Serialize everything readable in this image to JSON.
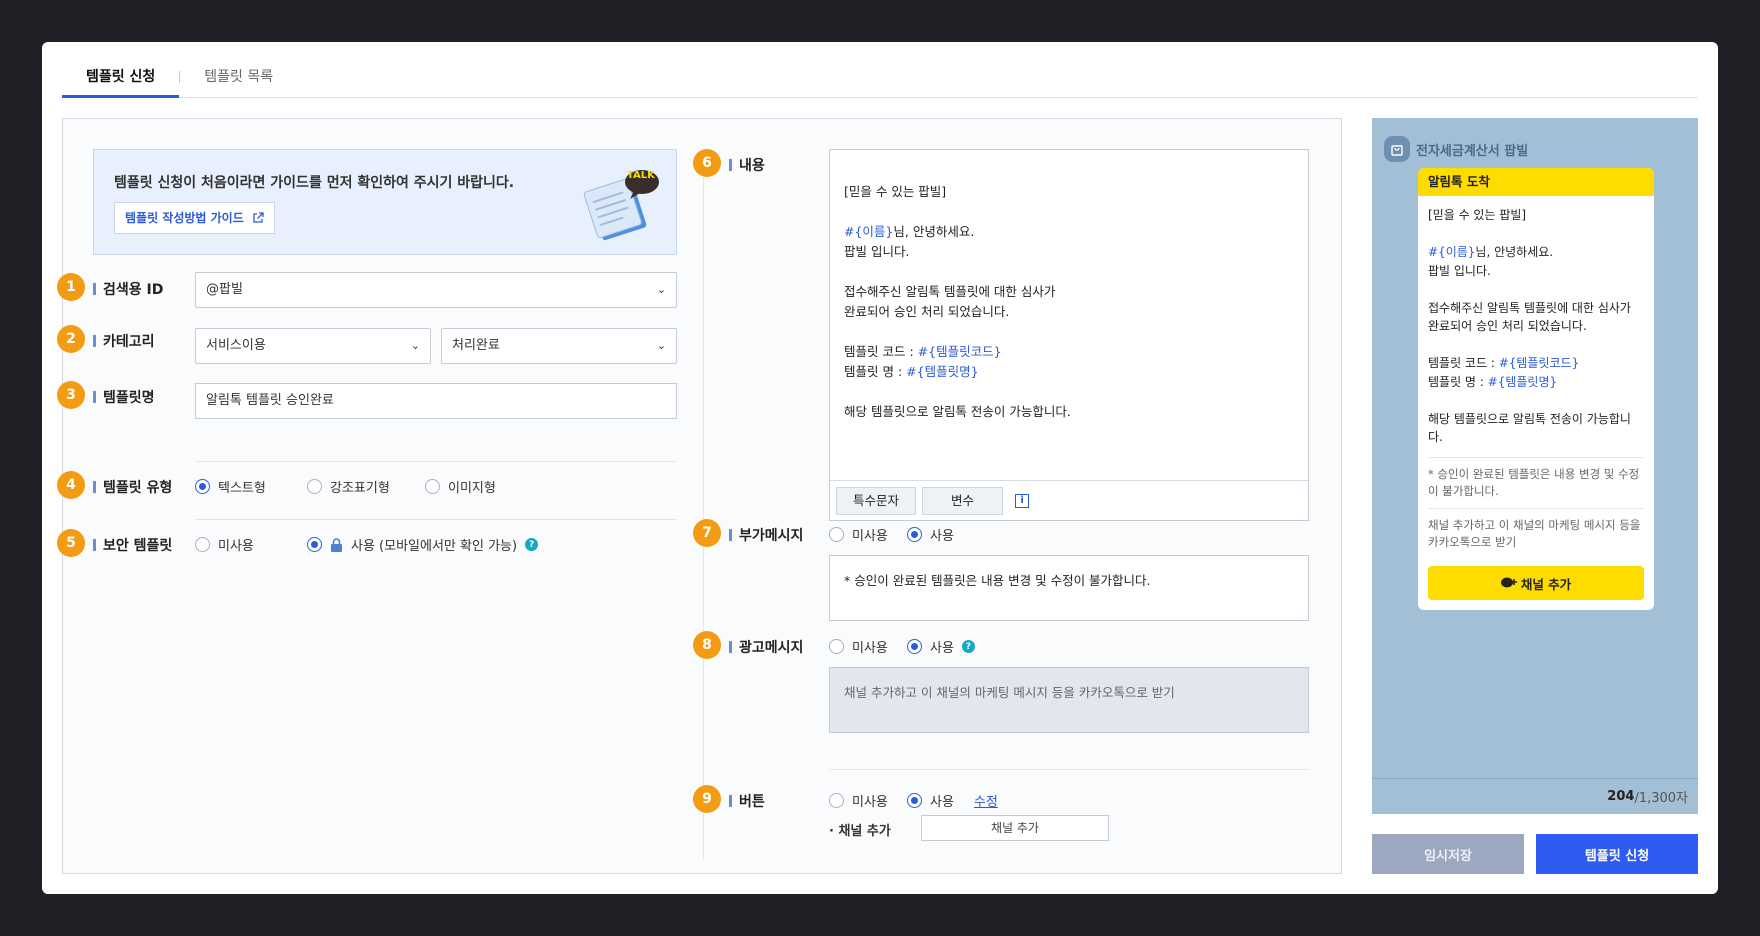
{
  "tabs": [
    {
      "label": "템플릿 신청",
      "active": true
    },
    {
      "label": "템플릿 목록",
      "active": false
    }
  ],
  "guide": {
    "text": "템플릿 신청이 처음이라면 가이드를 먼저 확인하여 주시기 바랍니다.",
    "button": "템플릿 작성방법 가이드",
    "talk": "TALK"
  },
  "fields": {
    "search_id": {
      "num": "1",
      "label": "검색용 ID",
      "value": "@팝빌"
    },
    "category": {
      "num": "2",
      "label": "카테고리",
      "value1": "서비스이용",
      "value2": "처리완료"
    },
    "name": {
      "num": "3",
      "label": "템플릿명",
      "value": "알림톡 템플릿 승인완료"
    },
    "type": {
      "num": "4",
      "label": "템플릿 유형",
      "options": [
        "텍스트형",
        "강조표기형",
        "이미지형"
      ],
      "selected": "텍스트형"
    },
    "secure": {
      "num": "5",
      "label": "보안 템플릿",
      "options": [
        "미사용",
        "사용 (모바일에서만 확인 가능)"
      ],
      "selected": "사용 (모바일에서만 확인 가능)",
      "help": "?"
    }
  },
  "content": {
    "num": "6",
    "label": "내용",
    "lines": [
      "[믿을 수 있는 팝빌]",
      "",
      "#{이름}|님, 안녕하세요.",
      "팝빌 입니다.",
      "",
      "접수해주신 알림톡 템플릿에 대한 심사가",
      "완료되어 승인 처리 되었습니다.",
      "",
      "템플릿 코드 : |#{템플릿코드}",
      "템플릿 명 : |#{템플릿명}",
      "",
      "해당 템플릿으로 알림톡 전송이 가능합니다."
    ],
    "text_1": "[믿을 수 있는 팝빌]",
    "var_name": "#{이름}",
    "text_2": "님, 안녕하세요.",
    "text_3": "팝빌 입니다.",
    "text_4": "접수해주신 알림톡 템플릿에 대한 심사가",
    "text_5": "완료되어 승인 처리 되었습니다.",
    "text_6": "템플릿 코드 : ",
    "var_code": "#{템플릿코드}",
    "text_7": "템플릿 명 : ",
    "var_tname": "#{템플릿명}",
    "text_8": "해당 템플릿으로 알림톡 전송이 가능합니다.",
    "special_chars": "특수문자",
    "variable": "변수",
    "info": "i"
  },
  "extra_msg": {
    "num": "7",
    "label": "부가메시지",
    "options": [
      "미사용",
      "사용"
    ],
    "selected": "사용",
    "text": "* 승인이 완료된 템플릿은 내용 변경 및 수정이 불가합니다."
  },
  "ad_msg": {
    "num": "8",
    "label": "광고메시지",
    "options": [
      "미사용",
      "사용"
    ],
    "selected": "사용",
    "help": "?",
    "text": "채널 추가하고 이 채널의 마케팅 메시지 등을 카카오톡으로 받기"
  },
  "button_field": {
    "num": "9",
    "label": "버튼",
    "options": [
      "미사용",
      "사용"
    ],
    "selected": "사용",
    "edit": "수정",
    "channel_label": "· 채널 추가",
    "channel_value": "채널 추가"
  },
  "preview": {
    "sender": "전자세금계산서 팝빌",
    "card_title": "알림톡 도착",
    "body_1": "[믿을 수 있는 팝빌]",
    "var_name": "#{이름}",
    "body_2": "님, 안녕하세요.",
    "body_3": "팝빌 입니다.",
    "body_4": "접수해주신 알림톡 템플릿에 대한 심사가 완료되어 승인 처리 되었습니다.",
    "body_5": "템플릿 코드 : ",
    "var_code": "#{템플릿코드}",
    "body_6": "템플릿 명 : ",
    "var_tname": "#{템플릿명}",
    "body_7": "해당 템플릿으로 알림톡 전송이 가능합니다.",
    "note_1": "* 승인이 완료된 템플릿은 내용 변경 및 수정이 불가합니다.",
    "note_2": "채널 추가하고 이 채널의 마케팅 메시지 등을 카카오톡으로 받기",
    "channel_btn": "채널 추가",
    "count": "204",
    "max": "/1,300자"
  },
  "actions": {
    "save": "임시저장",
    "submit": "템플릿 신청"
  },
  "colors": {
    "accent": "#2b5bd7",
    "badge": "#f39b12",
    "kakao_yellow": "#fedc00",
    "preview_bg": "#a3bfd6"
  }
}
